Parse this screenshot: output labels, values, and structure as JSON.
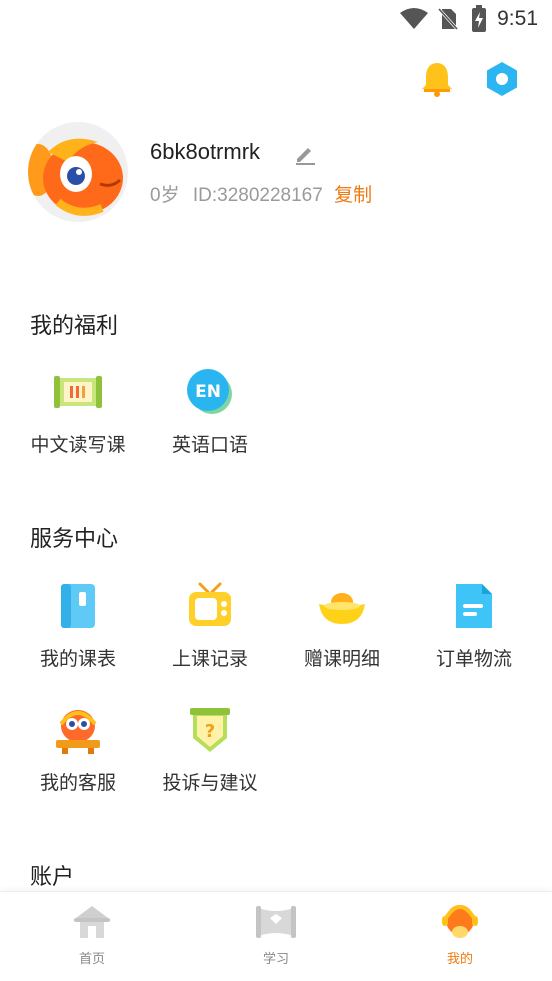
{
  "status_bar": {
    "time": "9:51"
  },
  "header": {
    "notification_icon": "bell-icon",
    "settings_icon": "hexagon-settings-icon",
    "accent": "#f07a12"
  },
  "profile": {
    "username": "6bk8otrmrk",
    "age": "0岁",
    "id_text": "ID:3280228167",
    "copy_label": "复制"
  },
  "welfare": {
    "title": "我的福利",
    "items": [
      {
        "label": "中文读写课",
        "icon": "scroll-icon"
      },
      {
        "label": "英语口语",
        "icon": "en-bubble-icon",
        "badge": "EN"
      }
    ]
  },
  "service": {
    "title": "服务中心",
    "items": [
      {
        "label": "我的课表",
        "icon": "notebook-icon"
      },
      {
        "label": "上课记录",
        "icon": "tv-icon"
      },
      {
        "label": "赠课明细",
        "icon": "gold-ingot-icon"
      },
      {
        "label": "订单物流",
        "icon": "document-icon"
      },
      {
        "label": "我的客服",
        "icon": "mascot-service-icon"
      },
      {
        "label": "投诉与建议",
        "icon": "question-shield-icon"
      }
    ]
  },
  "account": {
    "title": "账户"
  },
  "bottom_nav": {
    "tabs": [
      {
        "label": "首页",
        "icon": "home-icon"
      },
      {
        "label": "学习",
        "icon": "study-icon"
      },
      {
        "label": "我的",
        "icon": "mine-icon",
        "active": true
      }
    ]
  }
}
